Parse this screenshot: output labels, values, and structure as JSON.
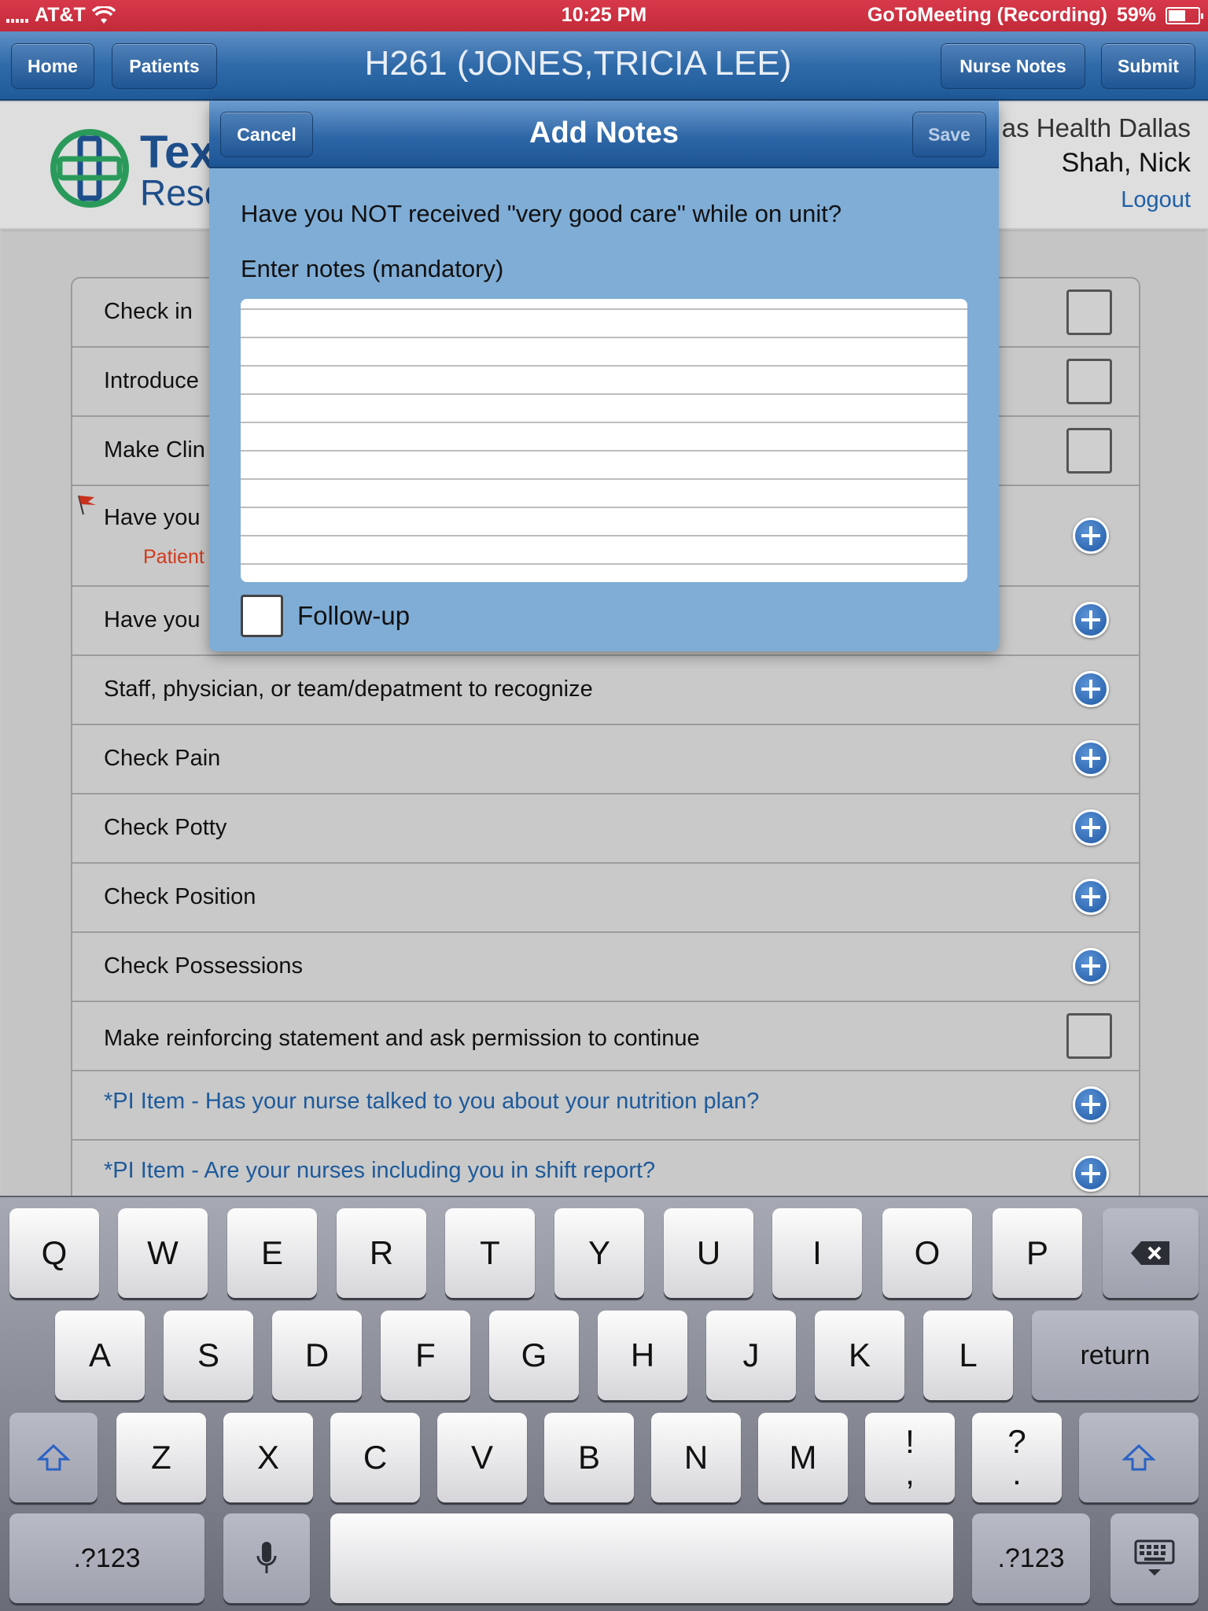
{
  "status_bar": {
    "carrier": "AT&T",
    "time": "10:25 PM",
    "recording": "GoToMeeting (Recording)",
    "battery": "59%",
    "battery_level": 0.59
  },
  "nav": {
    "home_label": "Home",
    "patients_label": "Patients",
    "title": "H261 (JONES,TRICIA LEE)",
    "nurse_notes_label": "Nurse Notes",
    "submit_label": "Submit"
  },
  "header": {
    "logo_text_1": "Tex",
    "logo_text_2": "Reso",
    "org": "as Health Dallas",
    "user": "Shah, Nick",
    "logout_label": "Logout"
  },
  "list": {
    "items": [
      {
        "label": "Check in",
        "control": "checkbox"
      },
      {
        "label": "Introduce",
        "control": "checkbox"
      },
      {
        "label": "Make Clin",
        "control": "checkbox"
      },
      {
        "label": "Have you",
        "sub": "Patient",
        "control": "plus",
        "flag": true
      },
      {
        "label": "Have you",
        "control": "plus"
      },
      {
        "label": "Staff, physician, or team/depatment to recognize",
        "control": "plus"
      },
      {
        "label": "Check Pain",
        "control": "plus"
      },
      {
        "label": "Check Potty",
        "control": "plus"
      },
      {
        "label": "Check Position",
        "control": "plus"
      },
      {
        "label": "Check Possessions",
        "control": "plus"
      },
      {
        "label": "Make reinforcing statement and ask permission to continue",
        "control": "checkbox"
      },
      {
        "label": "*PI Item - Has your nurse talked to you about your nutrition plan?",
        "control": "plus"
      },
      {
        "label": "*PI Item - Are your nurses including you in shift report?",
        "control": "plus"
      }
    ]
  },
  "modal": {
    "cancel_label": "Cancel",
    "title": "Add Notes",
    "save_label": "Save",
    "question": "Have you NOT received \"very good care\" while on unit?",
    "notes_label": "Enter notes (mandatory)",
    "notes_value": "",
    "followup_label": "Follow-up"
  },
  "keyboard": {
    "row1": [
      "Q",
      "W",
      "E",
      "R",
      "T",
      "Y",
      "U",
      "I",
      "O",
      "P"
    ],
    "row2": [
      "A",
      "S",
      "D",
      "F",
      "G",
      "H",
      "J",
      "K",
      "L"
    ],
    "row3": [
      "Z",
      "X",
      "C",
      "V",
      "B",
      "N",
      "M"
    ],
    "return_label": "return",
    "numbers_label": ".?123",
    "excl_top": "!",
    "excl_bottom": ",",
    "quest_top": "?",
    "quest_bottom": "."
  },
  "colors": {
    "status_bar": "#c22a3a",
    "nav_blue": "#2f6aa9",
    "modal_bg": "#7fadd6",
    "link_blue": "#1f5fa8",
    "alert_red": "#d23a1c"
  }
}
